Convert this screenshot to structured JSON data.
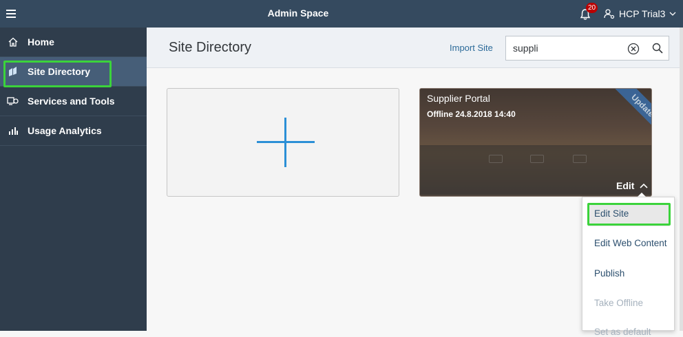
{
  "topbar": {
    "title": "Admin Space",
    "notification_count": "20",
    "user_name": "HCP Trial3"
  },
  "sidebar": {
    "items": [
      {
        "label": "Home",
        "icon": "home-icon"
      },
      {
        "label": "Site Directory",
        "icon": "site-directory-icon",
        "active": true
      },
      {
        "label": "Services and Tools",
        "icon": "services-icon"
      },
      {
        "label": "Usage Analytics",
        "icon": "analytics-icon"
      }
    ]
  },
  "header": {
    "title": "Site Directory",
    "import_label": "Import Site",
    "search_value": "suppli"
  },
  "site_tile": {
    "name": "Supplier Portal",
    "status": "Offline 24.8.2018 14:40",
    "ribbon": "Updated",
    "edit_label": "Edit"
  },
  "dropdown": {
    "items": [
      {
        "label": "Edit Site",
        "selected": true
      },
      {
        "label": "Edit Web Content"
      },
      {
        "label": "Publish"
      },
      {
        "label": "Take Offline",
        "disabled": true
      },
      {
        "label": "Set as default",
        "disabled": true
      }
    ]
  },
  "colors": {
    "shell": "#354a5f",
    "sidebar": "#2f3d4c",
    "sidebar_active": "#465e78",
    "highlight": "#3bd33b",
    "accent": "#2b8fd6",
    "link": "#2c6a99"
  }
}
